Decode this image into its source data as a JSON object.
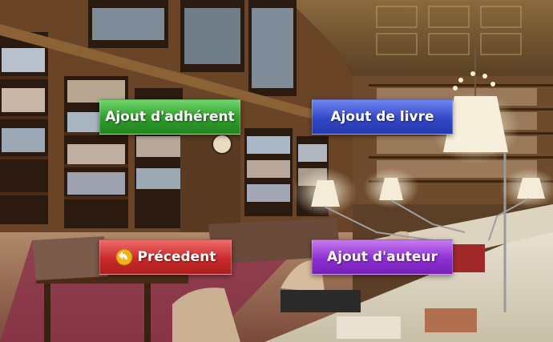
{
  "buttons": {
    "add_member": "Ajout d'adhérent",
    "add_book": "Ajout de livre",
    "previous": "Précedent",
    "add_author": "Ajout d'auteur"
  },
  "icons": {
    "previous": "back-arrow-icon"
  },
  "colors": {
    "green": "#2e9b2a",
    "blue": "#3347c8",
    "red": "#c92a2a",
    "purple": "#8c2fd1"
  },
  "background": {
    "scene": "library reading room"
  }
}
